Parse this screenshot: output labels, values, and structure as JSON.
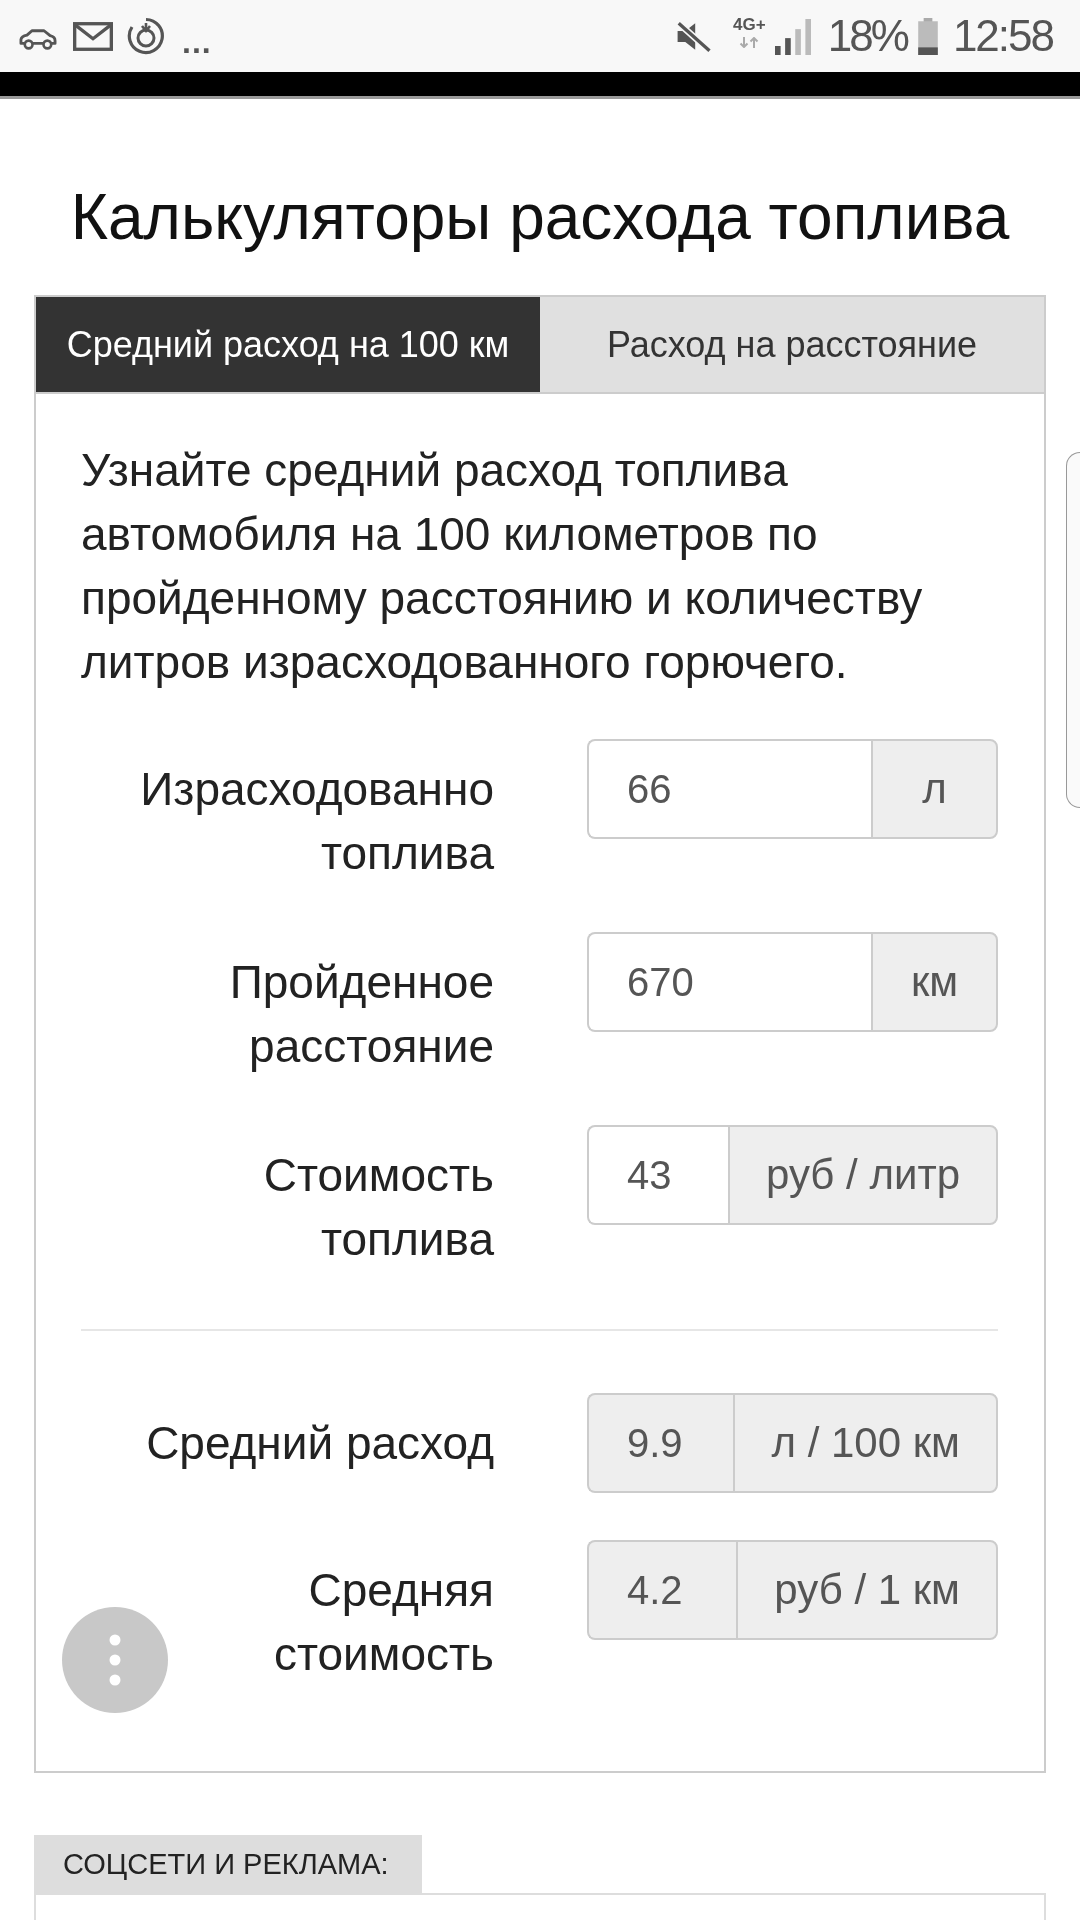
{
  "status_bar": {
    "more_notifications": "...",
    "network": "4G+",
    "battery": "18%",
    "time": "12:58"
  },
  "title": "Калькуляторы расхода топлива",
  "tabs": [
    {
      "label": "Средний расход на 100 км",
      "selected": true
    },
    {
      "label": "Расход на расстояние",
      "selected": false
    }
  ],
  "description": "Узнайте средний расход топлива автомобиля на 100 километров по пройденному расстоянию и количеству литров израсходованного горючего.",
  "inputs": [
    {
      "label": "Израсходованно топлива",
      "value": "66",
      "unit": "л",
      "readonly": false
    },
    {
      "label": "Пройденное расстояние",
      "value": "670",
      "unit": "км",
      "readonly": false
    },
    {
      "label": "Стоимость топлива",
      "value": "43",
      "unit": "руб / литр",
      "readonly": false
    }
  ],
  "results": [
    {
      "label": "Средний расход",
      "value": "9.9",
      "unit": "л / 100 км",
      "readonly": true
    },
    {
      "label": "Средняя стоимость",
      "value": "4.2",
      "unit": "руб / 1 км",
      "readonly": true
    }
  ],
  "section_header": {
    "label": "СОЦСЕТИ И РЕКЛАМА:"
  }
}
